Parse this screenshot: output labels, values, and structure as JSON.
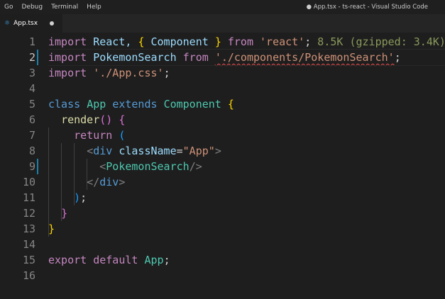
{
  "menu": [
    "Go",
    "Debug",
    "Terminal",
    "Help"
  ],
  "window_title": "● App.tsx - ts-react - Visual Studio Code",
  "tab": {
    "icon": "react-tsx-icon",
    "label": "App.tsx",
    "modified": true
  },
  "editor": {
    "line_numbers": [
      "1",
      "2",
      "3",
      "4",
      "5",
      "6",
      "7",
      "8",
      "9",
      "10",
      "11",
      "12",
      "13",
      "14",
      "15",
      "16"
    ],
    "active_line": 2,
    "lines": {
      "l1": {
        "kw1": "import",
        "t1": " React, ",
        "b1": "{",
        "t2": " Component ",
        "b2": "}",
        "t3": " ",
        "kw2": "from",
        "t4": " ",
        "str": "'react'",
        "t5": ";",
        "hint": " 8.5K (gzipped: 3.4K)"
      },
      "l2": {
        "kw1": "import",
        "t1": " PokemonSearch ",
        "kw2": "from",
        "t2": " ",
        "str": "'./components/PokemonSearch'",
        "t3": ";"
      },
      "l3": {
        "kw1": "import",
        "t1": " ",
        "str": "'./App.css'",
        "t2": ";"
      },
      "l5": {
        "kw1": "class",
        "t1": " ",
        "cls": "App",
        "t2": " ",
        "kw2": "extends",
        "t3": " ",
        "cls2": "Component",
        "t4": " ",
        "b": "{"
      },
      "l6": {
        "ind": "  ",
        "fn": "render",
        "p": "()",
        "t1": " ",
        "b": "{"
      },
      "l7": {
        "ind": "    ",
        "kw": "return",
        "t1": " ",
        "b": "("
      },
      "l8": {
        "ind": "      ",
        "lt": "<",
        "tag": "div",
        "t1": " ",
        "attr": "className",
        "eq": "=",
        "str": "\"App\"",
        "gt": ">"
      },
      "l9": {
        "ind": "        ",
        "lt": "<",
        "cls": "PokemonSearch",
        "end": "/>"
      },
      "l10": {
        "ind": "      ",
        "lt": "</",
        "tag": "div",
        "gt": ">"
      },
      "l11": {
        "ind": "    ",
        "b": ")",
        "t": ";"
      },
      "l12": {
        "ind": "  ",
        "b": "}"
      },
      "l13": {
        "b": "}"
      },
      "l15": {
        "kw1": "export",
        "t1": " ",
        "kw2": "default",
        "t2": " ",
        "id": "App",
        "t3": ";"
      }
    }
  },
  "colors": {
    "background": "#1e1e1e",
    "keyword": "#c586c0",
    "storage": "#569cd6",
    "class": "#4ec9b0",
    "string": "#ce9178",
    "function": "#dcdcaa",
    "bracket_level1": "#ffd700",
    "bracket_level2": "#da70d6",
    "bracket_level3": "#179fff",
    "error_squiggle": "#f14c4c",
    "import_cost_hint": "#8a9a5b"
  }
}
